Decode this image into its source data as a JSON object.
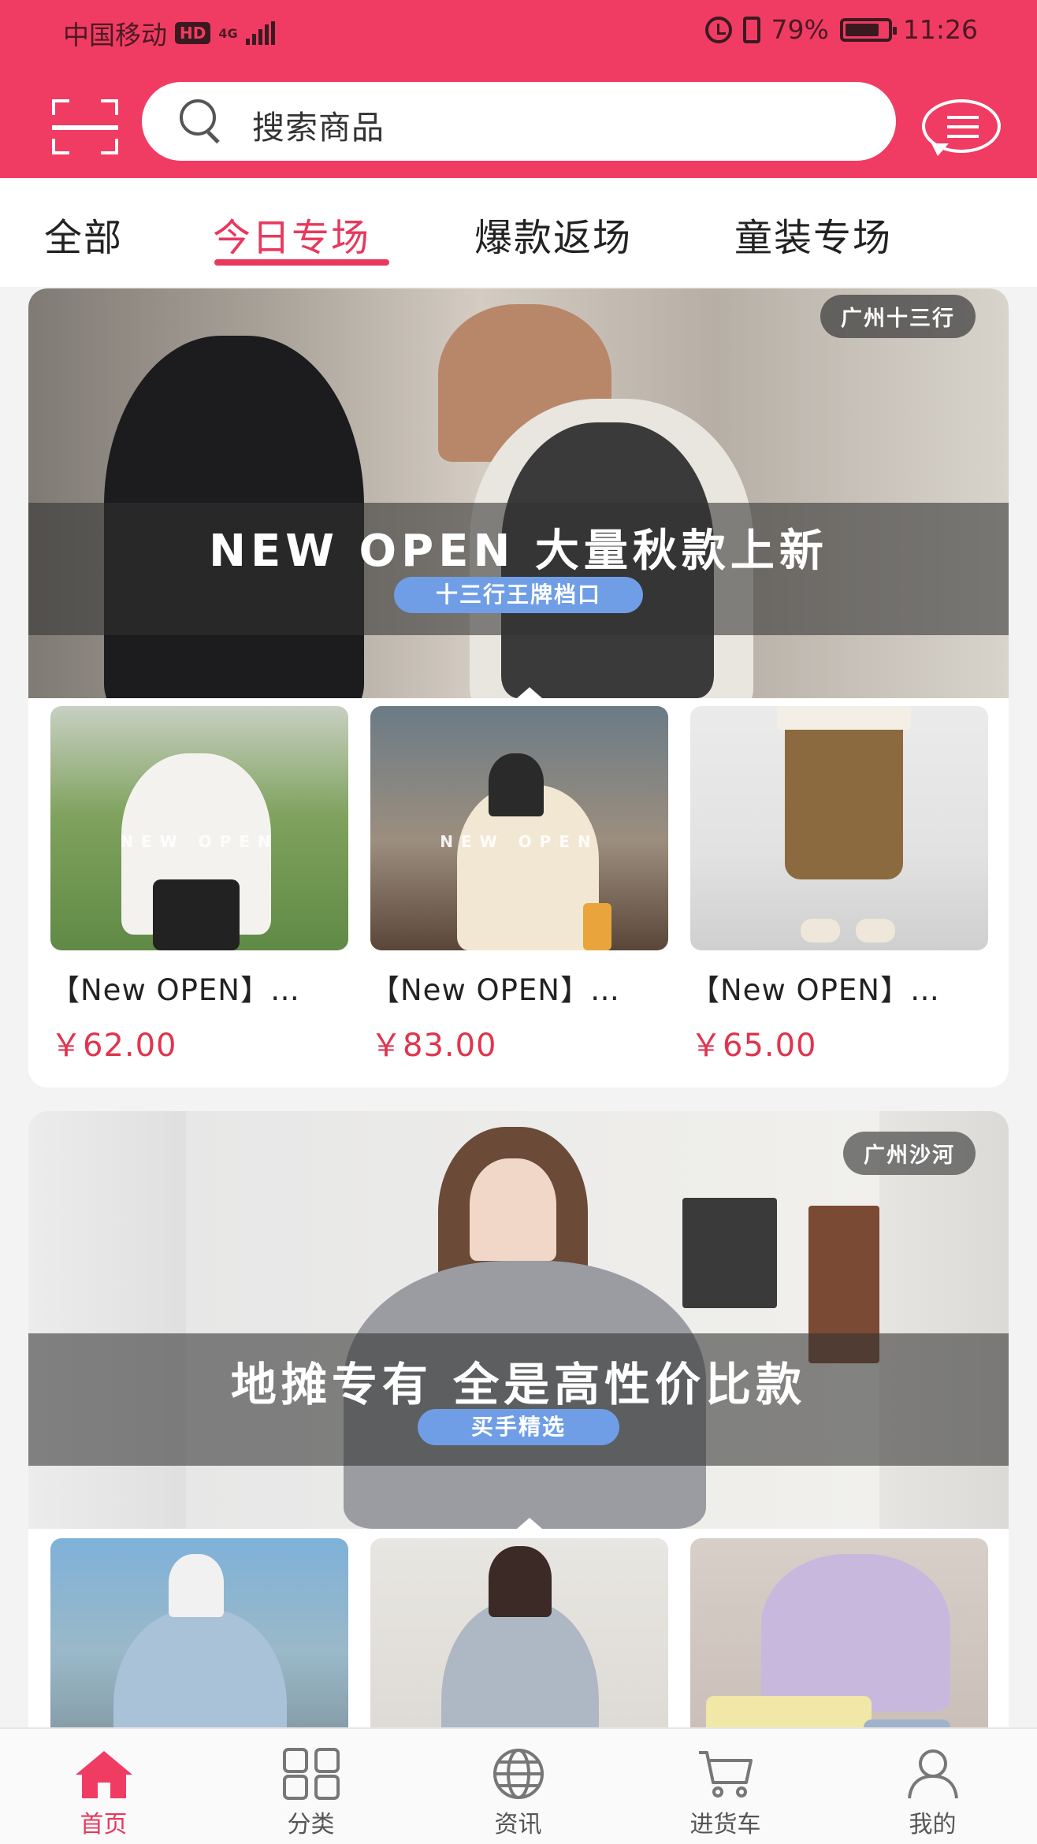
{
  "status_bar": {
    "carrier": "中国移动",
    "hd": "HD",
    "network": "4G",
    "battery": "79%",
    "time": "11:26"
  },
  "search": {
    "placeholder": "搜索商品"
  },
  "tabs": [
    {
      "label": "全部",
      "active": false
    },
    {
      "label": "今日专场",
      "active": true
    },
    {
      "label": "爆款返场",
      "active": false
    },
    {
      "label": "童装专场",
      "active": false
    }
  ],
  "sections": [
    {
      "banner": {
        "location": "广州十三行",
        "title": "NEW OPEN 大量秋款上新",
        "subtitle": "十三行王牌档口"
      },
      "products": [
        {
          "name": "【New OPEN】…",
          "price": "￥62.00",
          "overlay": "NEW OPEN"
        },
        {
          "name": "【New OPEN】…",
          "price": "￥83.00",
          "overlay": "NEW OPEN"
        },
        {
          "name": "【New OPEN】…",
          "price": "￥65.00",
          "overlay": ""
        }
      ]
    },
    {
      "banner": {
        "location": "广州沙河",
        "title": "地摊专有 全是高性价比款",
        "subtitle": "买手精选"
      },
      "products": [
        {
          "name": "",
          "price": ""
        },
        {
          "name": "",
          "price": ""
        },
        {
          "name": "",
          "price": ""
        }
      ]
    }
  ],
  "bottom_nav": [
    {
      "label": "首页",
      "icon": "home-icon",
      "active": true
    },
    {
      "label": "分类",
      "icon": "grid-icon",
      "active": false
    },
    {
      "label": "资讯",
      "icon": "globe-icon",
      "active": false
    },
    {
      "label": "进货车",
      "icon": "cart-icon",
      "active": false
    },
    {
      "label": "我的",
      "icon": "user-icon",
      "active": false
    }
  ],
  "colors": {
    "brand": "#f03c63",
    "price": "#e0354e",
    "pill": "#6f9ee6"
  }
}
